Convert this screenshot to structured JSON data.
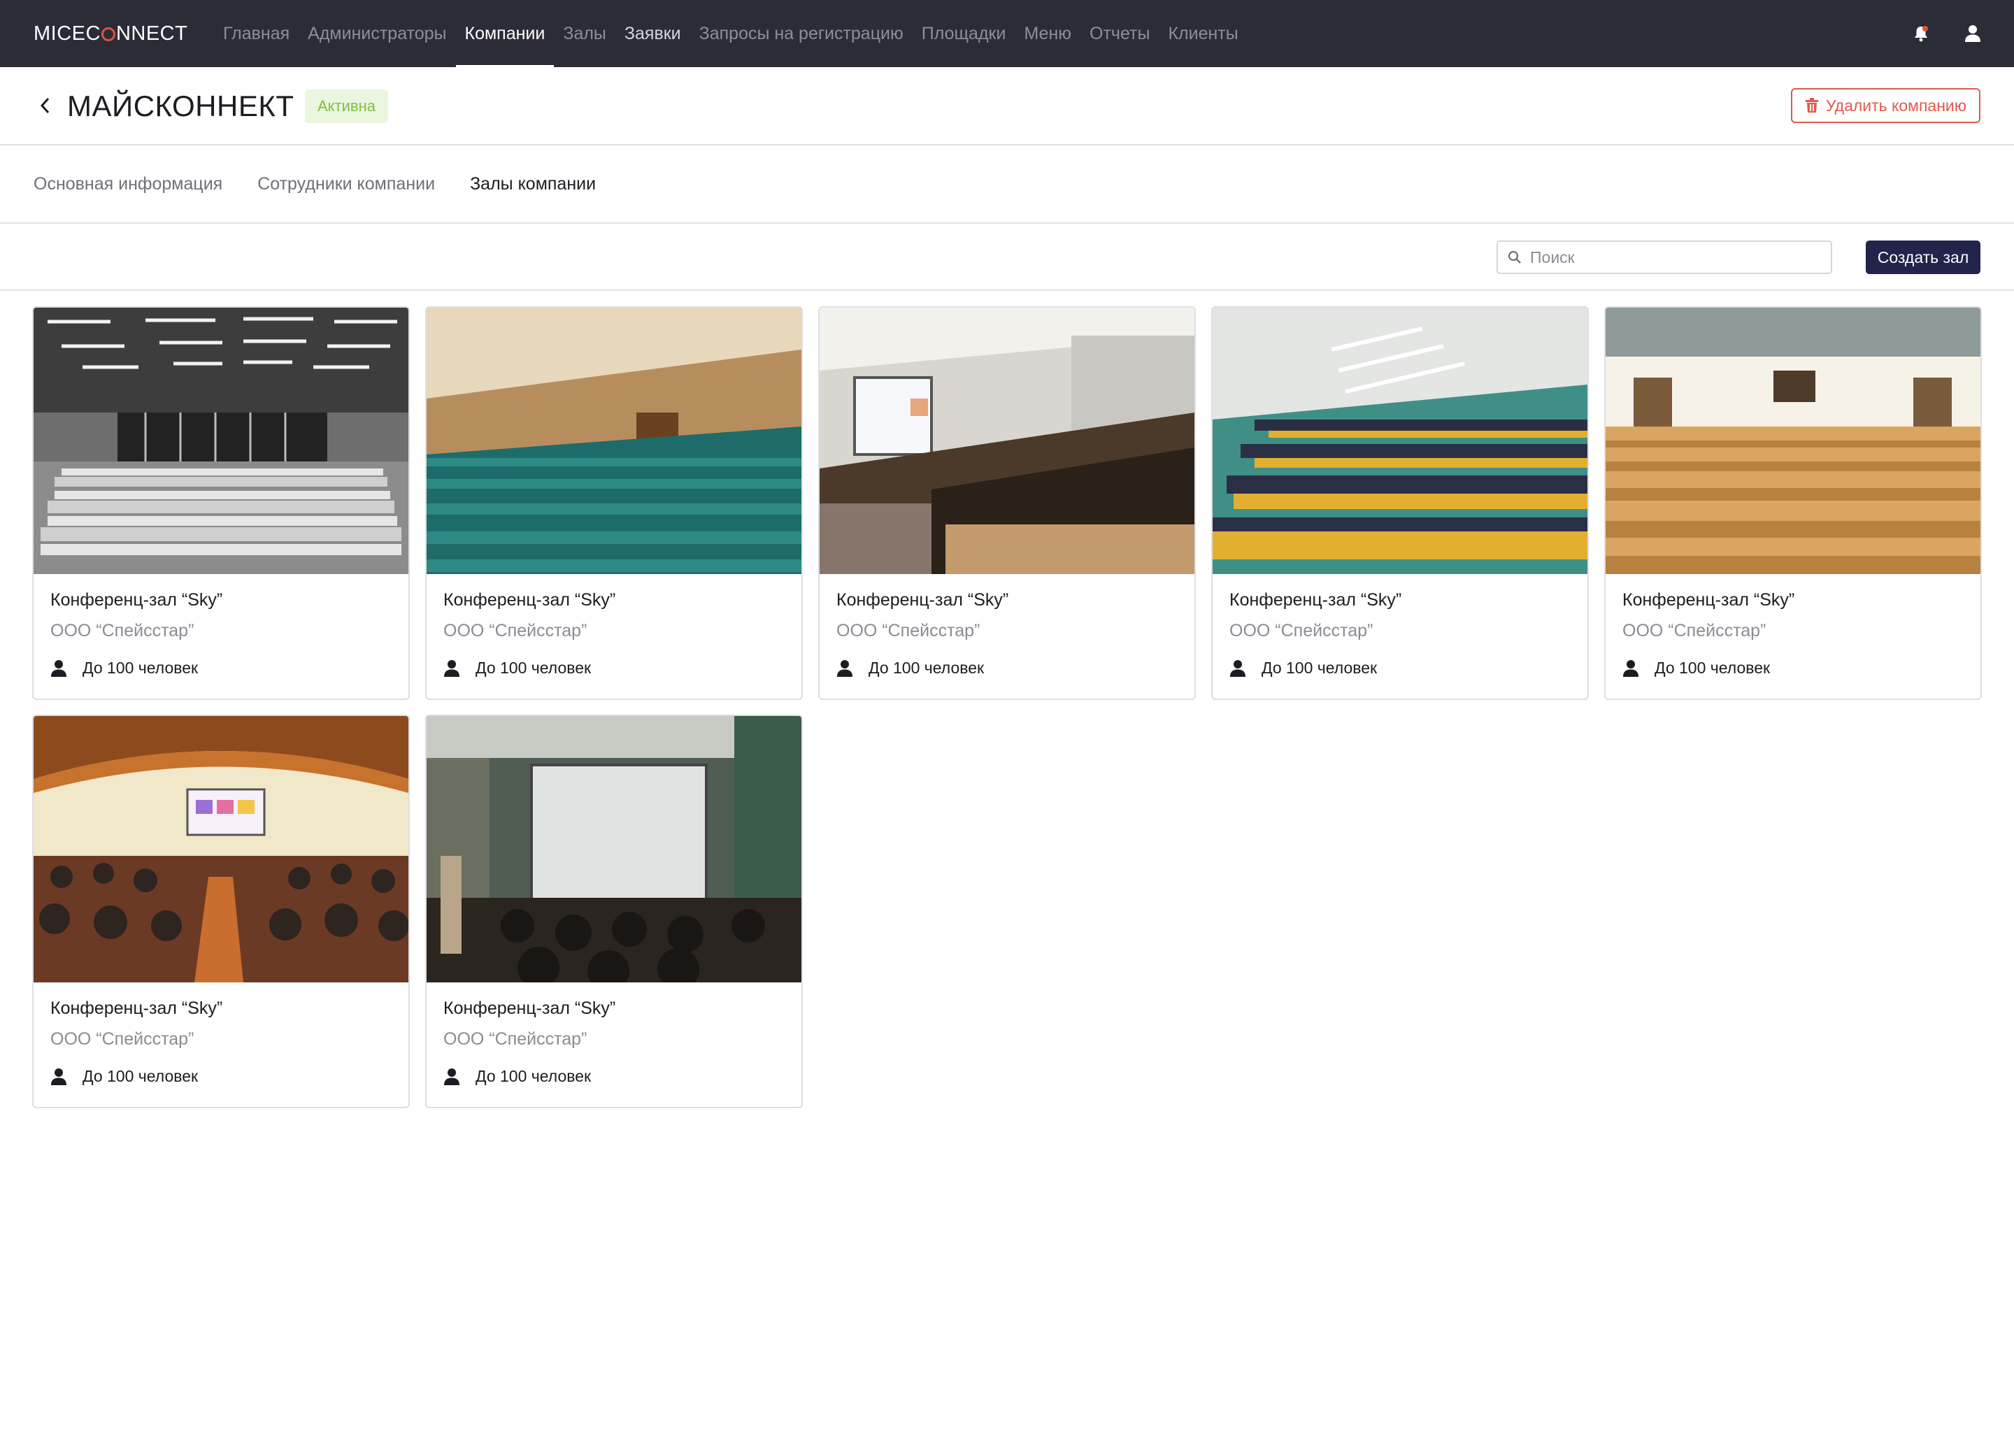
{
  "brand": {
    "logo_pre": "MICEC",
    "logo_post": "NNECT",
    "accent": "#e0533a"
  },
  "nav": {
    "items": [
      {
        "label": "Главная"
      },
      {
        "label": "Администраторы"
      },
      {
        "label": "Компании",
        "active": true
      },
      {
        "label": "Залы"
      },
      {
        "label": "Заявки"
      },
      {
        "label": "Запросы на регистрацию"
      },
      {
        "label": "Площадки"
      },
      {
        "label": "Меню"
      },
      {
        "label": "Отчеты"
      },
      {
        "label": "Клиенты"
      }
    ],
    "icons": [
      "bell-icon",
      "user-icon"
    ]
  },
  "header": {
    "title": "МАЙСКОННЕКТ",
    "status": "Активна",
    "delete_label": "Удалить компанию"
  },
  "tabs": [
    {
      "label": "Основная информация"
    },
    {
      "label": "Сотрудники компании"
    },
    {
      "label": "Залы компании",
      "active": true
    }
  ],
  "toolbar": {
    "search_placeholder": "Поиск",
    "create_label": "Создать зал"
  },
  "halls": [
    {
      "title": "Конференц-зал “Sky”",
      "company": "ООО “Спейсстар”",
      "capacity": "До 100 человек",
      "photo": "grayscale-classroom"
    },
    {
      "title": "Конференц-зал “Sky”",
      "company": "ООО “Спейсстар”",
      "capacity": "До 100 человек",
      "photo": "wood-hall-teal-seats"
    },
    {
      "title": "Конференц-зал “Sky”",
      "company": "ООО “Спейсстар”",
      "capacity": "До 100 человек",
      "photo": "lecture-hall-screen"
    },
    {
      "title": "Конференц-зал “Sky”",
      "company": "ООО “Спейсстар”",
      "capacity": "До 100 человек",
      "photo": "auditorium-yellow-seats"
    },
    {
      "title": "Конференц-зал “Sky”",
      "company": "ООО “Спейсстар”",
      "capacity": "До 100 человек",
      "photo": "theater-golden-seats"
    },
    {
      "title": "Конференц-зал “Sky”",
      "company": "ООО “Спейсстар”",
      "capacity": "До 100 человек",
      "photo": "conference-stage-crowd"
    },
    {
      "title": "Конференц-зал “Sky”",
      "company": "ООО “Спейсстар”",
      "capacity": "До 100 человек",
      "photo": "projection-room"
    }
  ]
}
